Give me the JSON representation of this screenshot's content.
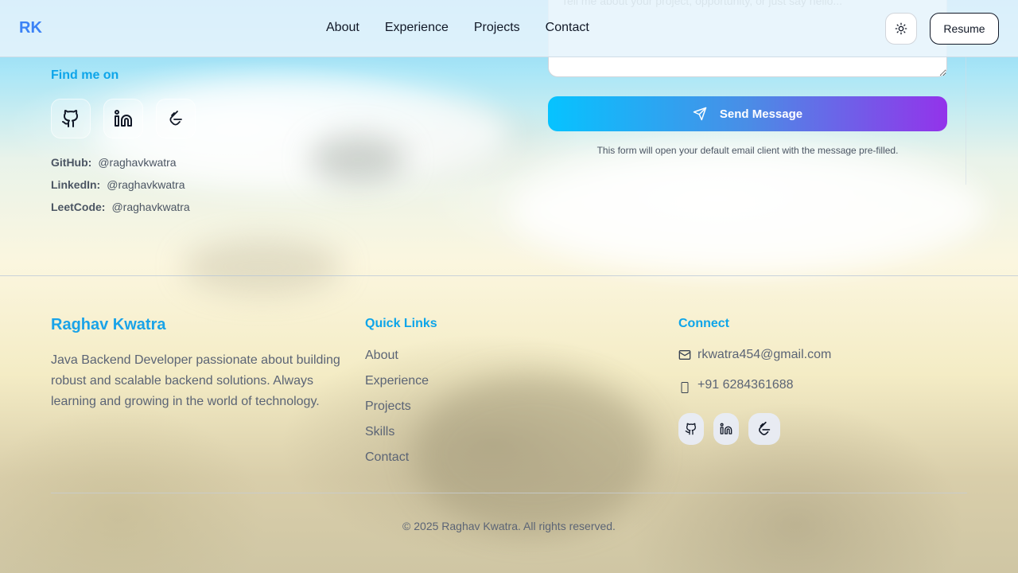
{
  "header": {
    "logo": "RK",
    "nav": [
      "About",
      "Experience",
      "Projects",
      "Contact"
    ],
    "theme_icon": "sun-icon",
    "resume_label": "Resume"
  },
  "contact": {
    "find_title": "Find me on",
    "social_icons": [
      "github-icon",
      "linkedin-icon",
      "leetcode-icon"
    ],
    "handles": [
      {
        "label": "GitHub:",
        "value": "@raghavkwatra"
      },
      {
        "label": "LinkedIn:",
        "value": "@raghavkwatra"
      },
      {
        "label": "LeetCode:",
        "value": "@raghavkwatra"
      }
    ],
    "message_placeholder": "Tell me about your project, opportunity, or just say hello...",
    "send_label": "Send Message",
    "send_icon": "send-icon",
    "form_note": "This form will open your default email client with the message pre-filled."
  },
  "footer": {
    "name": "Raghav Kwatra",
    "description": "Java Backend Developer passionate about building robust and scalable backend solutions. Always learning and growing in the world of technology.",
    "quick_links_title": "Quick Links",
    "quick_links": [
      "About",
      "Experience",
      "Projects",
      "Skills",
      "Contact"
    ],
    "connect_title": "Connect",
    "email": "rkwatra454@gmail.com",
    "phone": "+91 6284361688",
    "copyright": "© 2025 Raghav Kwatra. All rights reserved."
  },
  "colors": {
    "accent": "#0ea5e9",
    "logo": "#3b82f6",
    "gradient_start": "#06c3ff",
    "gradient_end": "#9333ea"
  }
}
